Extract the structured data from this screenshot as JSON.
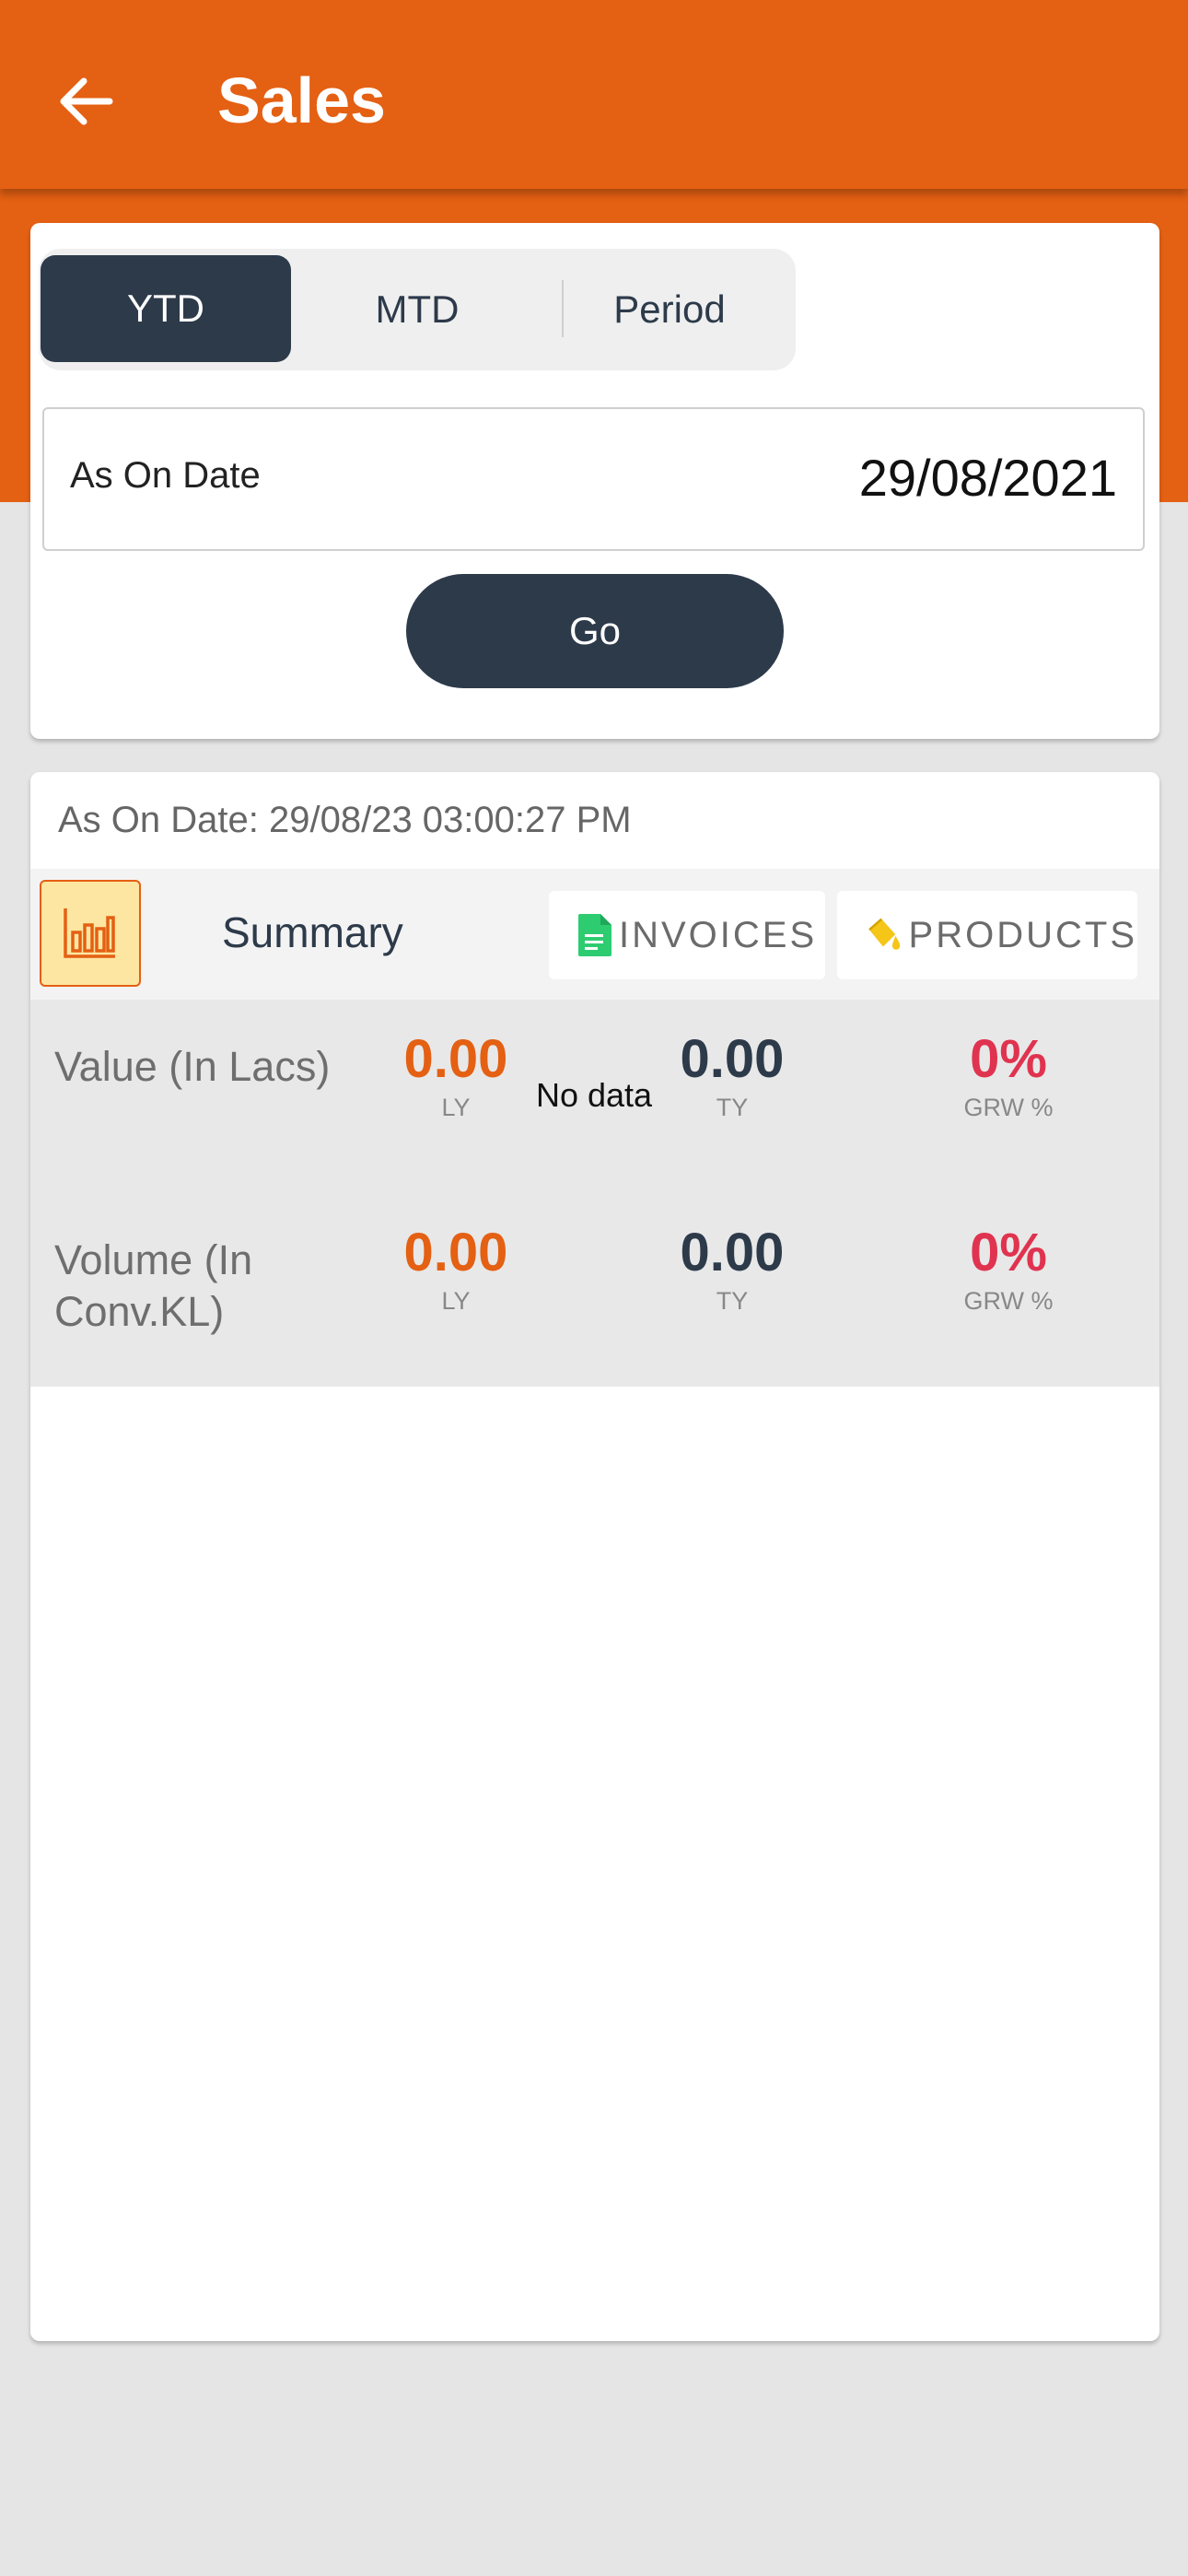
{
  "appbar": {
    "title": "Sales"
  },
  "filter": {
    "segments": {
      "ytd": "YTD",
      "mtd": "MTD",
      "period": "Period"
    },
    "date_label": "As On Date",
    "date_value": "29/08/2021",
    "go_label": "Go"
  },
  "report": {
    "as_of": "As On Date: 29/08/23 03:00:27 PM",
    "tabs": {
      "summary": "Summary",
      "invoices": "INVOICES",
      "products": "PRODUCTS"
    },
    "rows": [
      {
        "label": "Value (In Lacs)",
        "ly": "0.00",
        "ly_label": "LY",
        "ty": "0.00",
        "ty_label": "TY",
        "grw": "0%",
        "grw_label": "GRW %"
      },
      {
        "label": "Volume (In Conv.KL)",
        "ly": "0.00",
        "ly_label": "LY",
        "ty": "0.00",
        "ty_label": "TY",
        "grw": "0%",
        "grw_label": "GRW %"
      }
    ],
    "empty_text": "No data"
  },
  "colors": {
    "brand": "#e46013",
    "dark": "#2d3a4a",
    "growth": "#e0334f",
    "invoice_icon": "#2ecc71",
    "product_icon": "#f5c518"
  }
}
